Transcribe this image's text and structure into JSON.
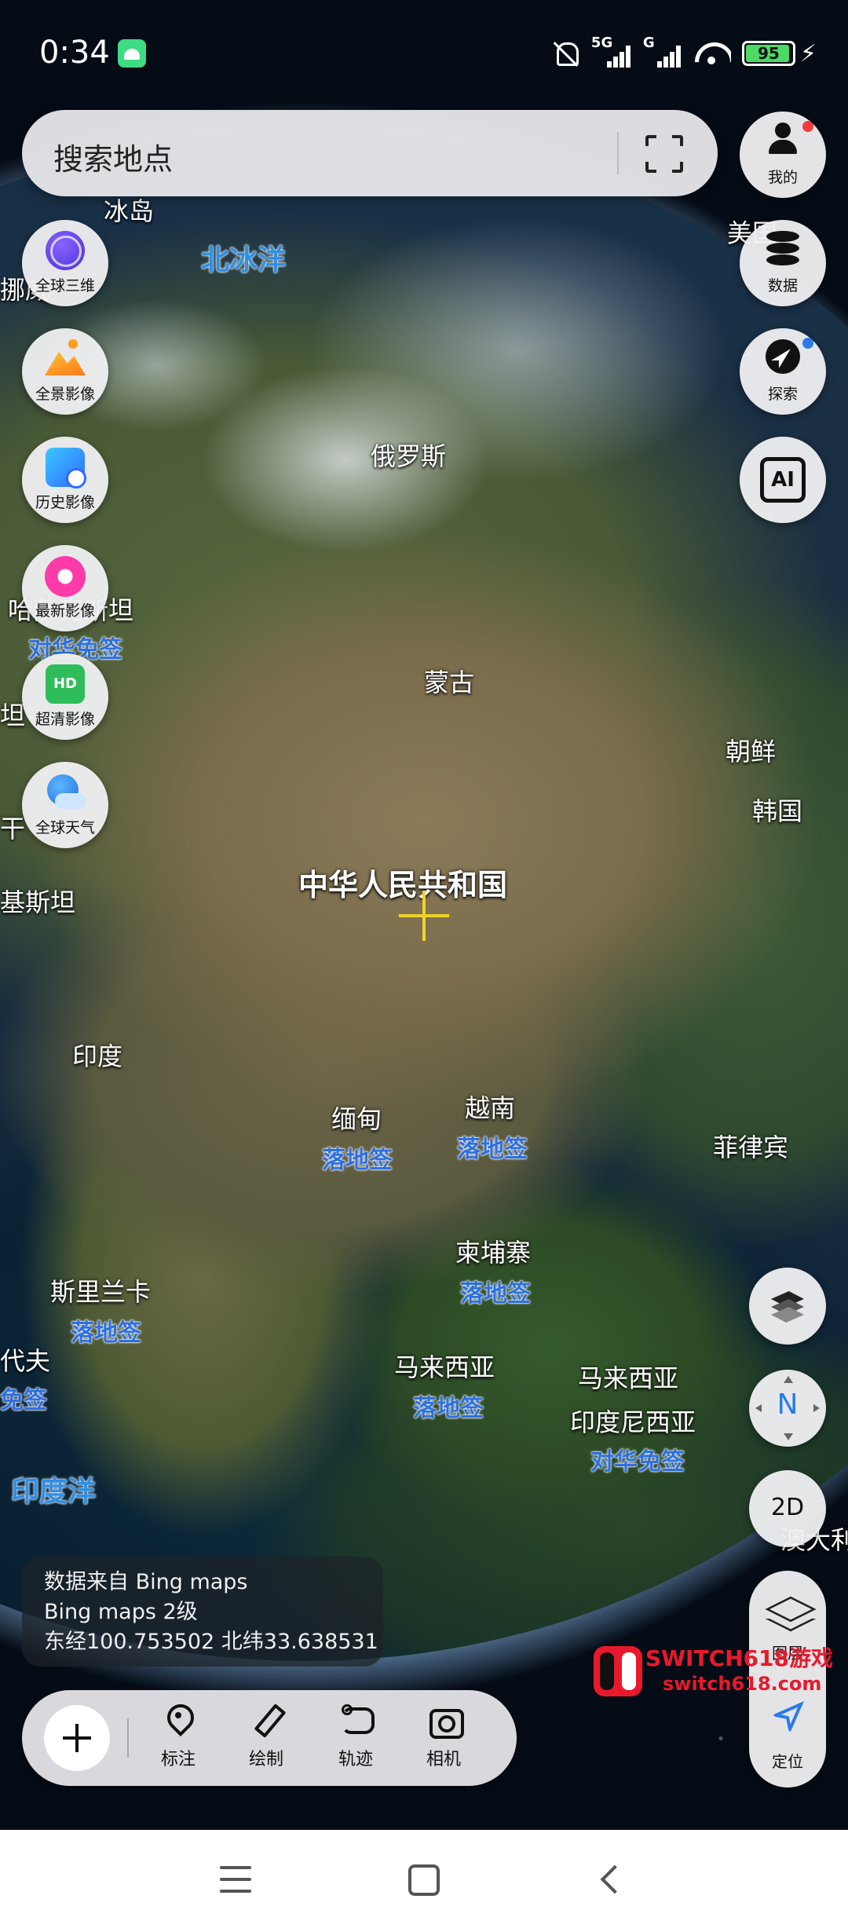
{
  "status_bar": {
    "time": "0:34",
    "signal_1_tag": "5G",
    "signal_2_tag": "G",
    "battery_percent": "95",
    "battery_level": 0.95,
    "charging_icon": "charging-bolt-icon",
    "colors": {
      "battery": "#4cd964"
    }
  },
  "search": {
    "placeholder": "搜索地点",
    "scan_icon": "fullscreen-scan-icon"
  },
  "right_buttons": {
    "profile_label": "我的",
    "data_label": "数据",
    "explore_label": "探索",
    "ai_label": "AI"
  },
  "left_buttons": [
    {
      "label": "全球三维",
      "icon": "globe-3d-icon"
    },
    {
      "label": "全景影像",
      "icon": "panorama-icon"
    },
    {
      "label": "历史影像",
      "icon": "history-imagery-icon"
    },
    {
      "label": "最新影像",
      "icon": "latest-imagery-icon"
    },
    {
      "label": "超清影像",
      "icon": "hd-imagery-icon"
    },
    {
      "label": "全球天气",
      "icon": "weather-icon"
    }
  ],
  "map_labels": {
    "iceland": "冰岛",
    "arctic_ocean": "北冰洋",
    "usa": "美国",
    "norway": "挪威",
    "russia": "俄罗斯",
    "kazakhstan": "哈萨克斯坦",
    "kazakhstan_promo": "对华免签",
    "mongolia": "蒙古",
    "north_korea": "朝鲜",
    "south_korea": "韩国",
    "china": "中华人民共和国",
    "pakistan": "基斯坦",
    "india": "印度",
    "myanmar": "缅甸",
    "myanmar_promo": "落地签",
    "vietnam": "越南",
    "vietnam_promo": "落地签",
    "philippines": "菲律宾",
    "cambodia": "柬埔寨",
    "cambodia_promo": "落地签",
    "sri_lanka": "斯里兰卡",
    "sri_lanka_promo": "落地签",
    "maldives": "代夫",
    "maldives_promo": "免签",
    "malaysia_west": "马来西亚",
    "malaysia_west_promo": "落地签",
    "malaysia_east": "马来西亚",
    "indonesia": "印度尼西亚",
    "indonesia_promo": "对华免签",
    "indian_ocean": "印度洋",
    "australia": "澳大利",
    "edge_left_1": "坦",
    "edge_left_2": "干"
  },
  "map_controls": {
    "layer_switch_icon": "layer-switch-icon",
    "north_label": "N",
    "mode_label": "2D",
    "layers_label": "图层",
    "locate_label": "定位"
  },
  "info": {
    "source": "数据来自 Bing maps",
    "level": "Bing maps   2级",
    "coords": "东经100.753502  北纬33.638531"
  },
  "toolbar": {
    "add_icon": "plus-icon",
    "items": [
      {
        "label": "标注",
        "icon": "pin-icon"
      },
      {
        "label": "绘制",
        "icon": "draw-icon"
      },
      {
        "label": "轨迹",
        "icon": "track-icon"
      },
      {
        "label": "相机",
        "icon": "camera-icon"
      }
    ]
  },
  "watermark": {
    "title": "SWITCH618游戏",
    "url": "switch618.com"
  },
  "nav_bar": {
    "menu_icon": "menu-icon",
    "home_icon": "home-icon",
    "back_icon": "back-icon"
  }
}
